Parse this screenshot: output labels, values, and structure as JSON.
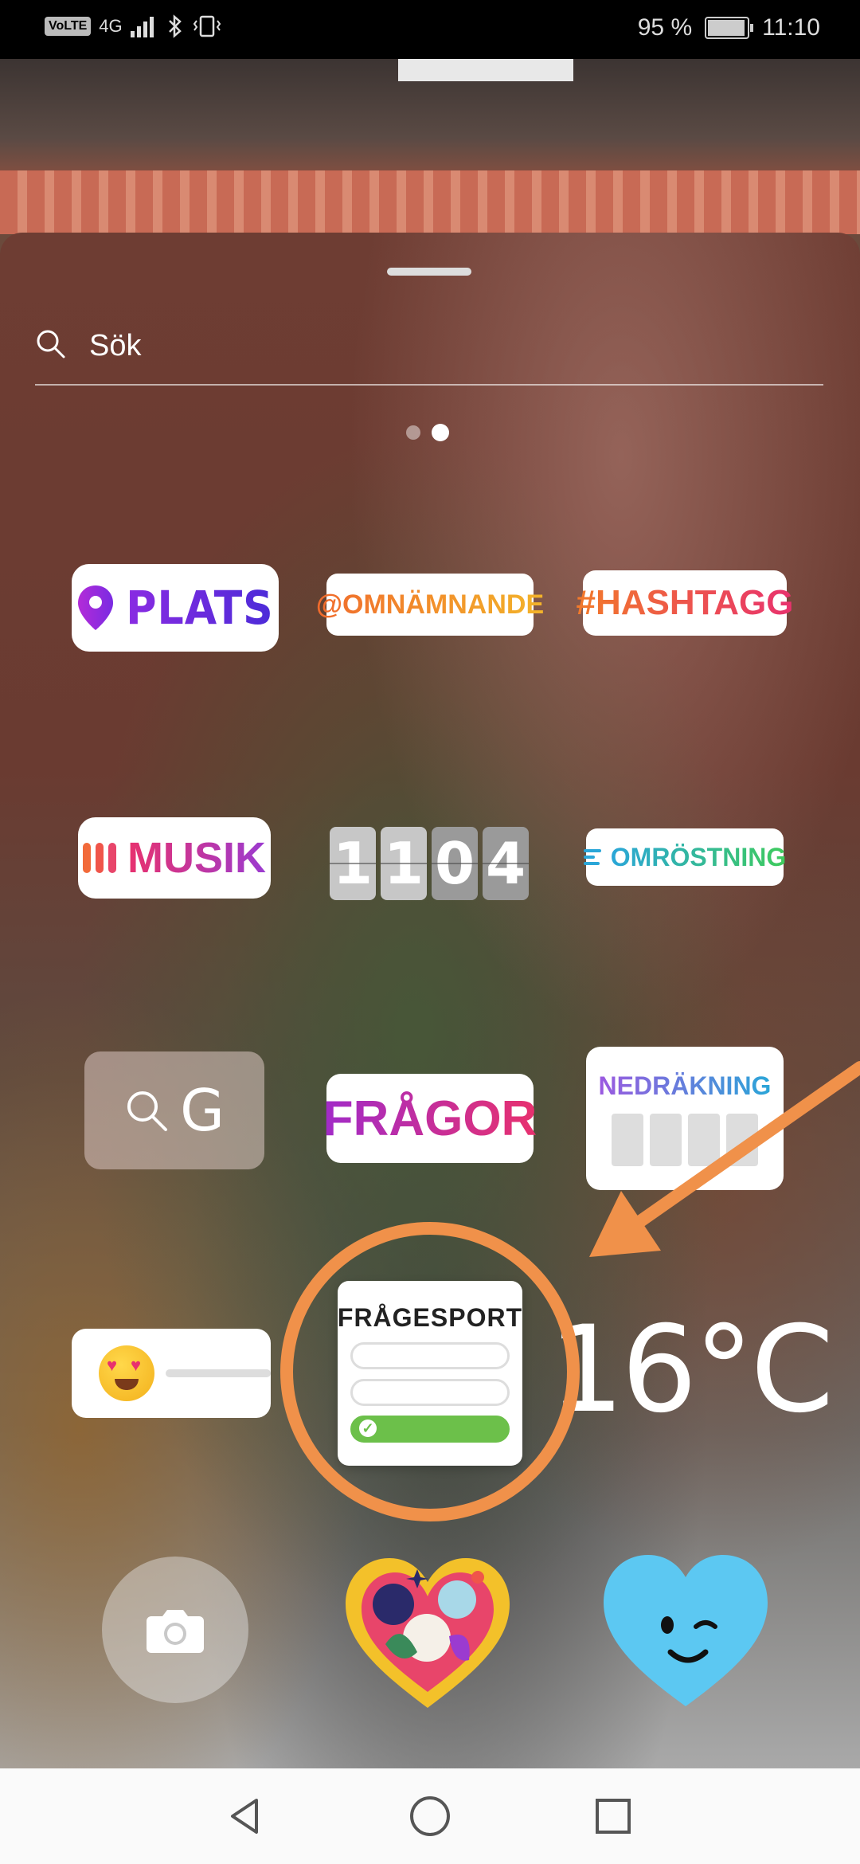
{
  "status_bar": {
    "volte": "VoLTE",
    "network": "4G",
    "battery": "95 %",
    "time": "11:10"
  },
  "search": {
    "placeholder": "Sök"
  },
  "pager": {
    "pages": 2,
    "active": 2
  },
  "stickers": {
    "plats": "PLATS",
    "omnamnande": "@OMNÄMNANDE",
    "hashtag": "#HASHTAGG",
    "musik": "MUSIK",
    "clock_digits": [
      "1",
      "1",
      "0",
      "4"
    ],
    "omrostning": "OMRÖSTNING",
    "gif": "G",
    "fragor": "FRÅGOR",
    "nedrakning": "NEDRÄKNING",
    "fragesport": "FRÅGESPORT",
    "temperature": "16°C"
  },
  "colors": {
    "annotation": "#f0914a",
    "blue_heart": "#5cc8f2",
    "quiz_correct": "#6cc04a"
  },
  "icons": {
    "search": "search-icon",
    "location": "location-pin-icon",
    "camera": "camera-icon",
    "back": "back-triangle-icon",
    "home": "home-circle-icon",
    "recents": "recents-square-icon"
  }
}
